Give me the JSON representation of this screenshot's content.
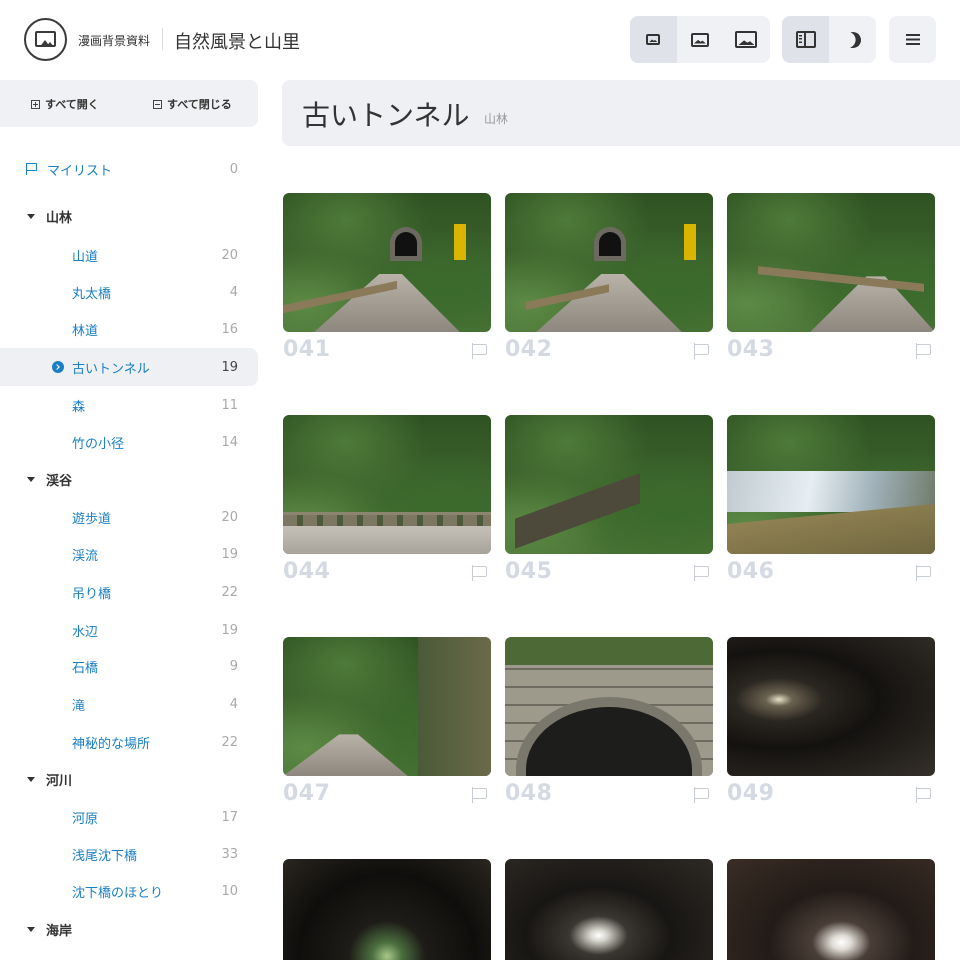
{
  "header": {
    "brand": "漫画背景資料",
    "site_title": "自然風景と山里",
    "size_buttons": [
      "thumbnail-small-icon",
      "thumbnail-medium-icon",
      "thumbnail-large-icon"
    ],
    "view_buttons": [
      "sidebar-toggle-icon",
      "dark-mode-icon"
    ],
    "menu_icon": "menu-icon"
  },
  "sidebar": {
    "expand_all": "すべて開く",
    "collapse_all": "すべて閉じる",
    "mylist": {
      "label": "マイリスト",
      "count": "0"
    },
    "groups": [
      {
        "label": "山林",
        "items": [
          {
            "label": "山道",
            "count": "20"
          },
          {
            "label": "丸太橋",
            "count": "4"
          },
          {
            "label": "林道",
            "count": "16"
          },
          {
            "label": "古いトンネル",
            "count": "19",
            "active": true
          },
          {
            "label": "森",
            "count": "11"
          },
          {
            "label": "竹の小径",
            "count": "14"
          }
        ]
      },
      {
        "label": "渓谷",
        "items": [
          {
            "label": "遊歩道",
            "count": "20"
          },
          {
            "label": "渓流",
            "count": "19"
          },
          {
            "label": "吊り橋",
            "count": "22"
          },
          {
            "label": "水辺",
            "count": "19"
          },
          {
            "label": "石橋",
            "count": "9"
          },
          {
            "label": "滝",
            "count": "4"
          },
          {
            "label": "神秘的な場所",
            "count": "22"
          }
        ]
      },
      {
        "label": "河川",
        "items": [
          {
            "label": "河原",
            "count": "17"
          },
          {
            "label": "浅尾沈下橋",
            "count": "33"
          },
          {
            "label": "沈下橋のほとり",
            "count": "10"
          }
        ]
      },
      {
        "label": "海岸",
        "items": []
      }
    ]
  },
  "main": {
    "title": "古いトンネル",
    "subtitle": "山林",
    "cards": [
      {
        "num": "041"
      },
      {
        "num": "042"
      },
      {
        "num": "043"
      },
      {
        "num": "044"
      },
      {
        "num": "045"
      },
      {
        "num": "046"
      },
      {
        "num": "047"
      },
      {
        "num": "048"
      },
      {
        "num": "049"
      },
      {
        "num": ""
      },
      {
        "num": ""
      },
      {
        "num": ""
      }
    ]
  },
  "colors": {
    "link": "#1a7fc4",
    "panel": "#f0f1f4",
    "number": "#d5dae2"
  }
}
